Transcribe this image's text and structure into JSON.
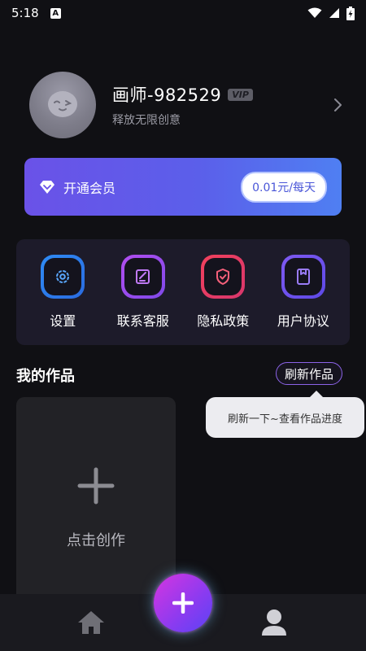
{
  "status_bar": {
    "time": "5:18",
    "icons": [
      "accessibility-icon",
      "wifi-icon",
      "signal-icon",
      "battery-charging-icon"
    ]
  },
  "profile": {
    "name": "画师-982529",
    "vip_badge": "VIP",
    "slogan": "释放无限创意",
    "icons": [
      "avatar-face",
      "chevron-right-icon"
    ]
  },
  "vip_banner": {
    "label": "开通会员",
    "price": "0.01元/每天",
    "icon": "diamond-icon"
  },
  "menu": {
    "items": [
      {
        "label": "设置",
        "icon": "gear-icon",
        "color": "#2f8cf5"
      },
      {
        "label": "联系客服",
        "icon": "edit-note-icon",
        "color": "#b24ef0"
      },
      {
        "label": "隐私政策",
        "icon": "shield-check-icon",
        "color": "#f2415c"
      },
      {
        "label": "用户协议",
        "icon": "document-icon",
        "color": "#7f5af2"
      }
    ]
  },
  "works": {
    "title": "我的作品",
    "refresh_label": "刷新作品",
    "tooltip": "刷新一下~查看作品进度",
    "create_label": "点击创作"
  },
  "bottom_nav": {
    "icons": [
      "home-icon",
      "plus-icon",
      "user-icon"
    ],
    "accent": "#c43cf0"
  }
}
